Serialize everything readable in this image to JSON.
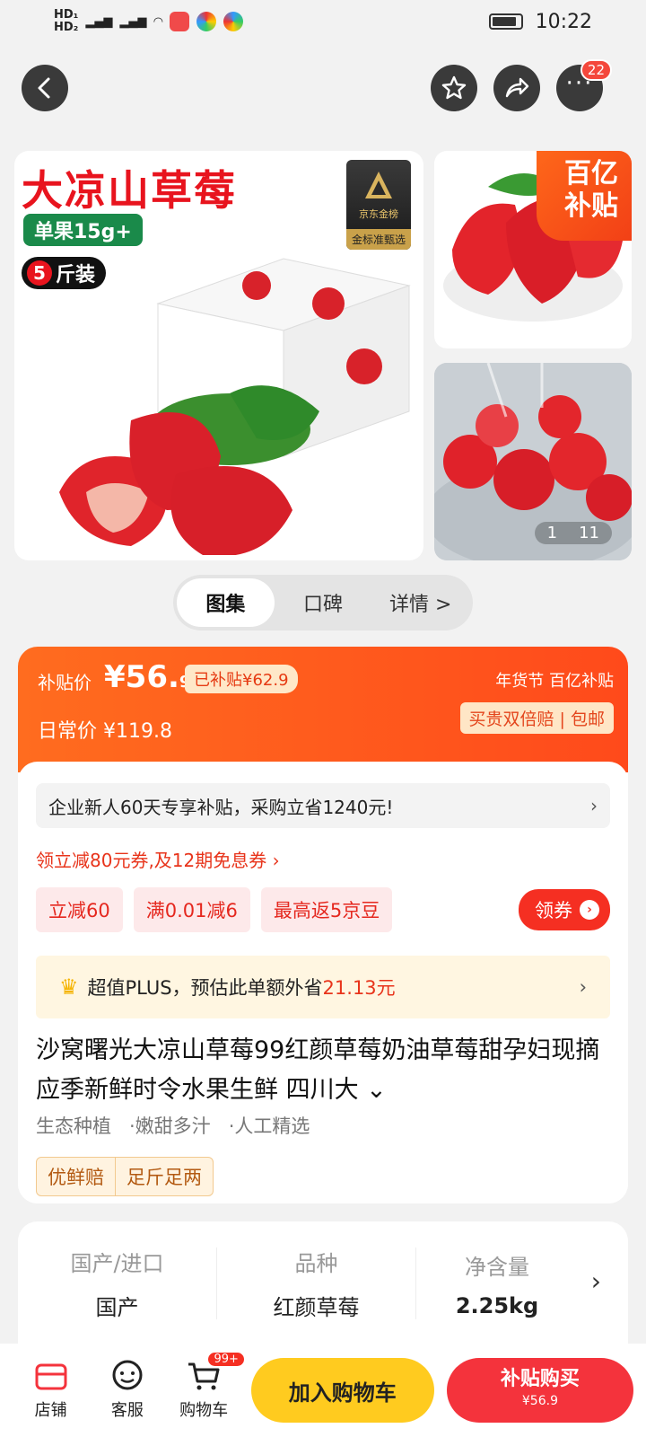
{
  "status_bar": {
    "left": "HD 4G 4G",
    "time": "10:22"
  },
  "top_nav": {
    "notification_count": "22"
  },
  "gallery": {
    "headline": "大凉山草莓",
    "weight_tag": "单果15g+",
    "pack_number": "5",
    "pack_suffix": "斤装",
    "gold_badge_top": "京东金榜",
    "gold_badge_bottom": "金标准甄选",
    "subsidy_badge_line1": "百亿",
    "subsidy_badge_line2": "补贴",
    "counter_current": "1",
    "counter_total": "11"
  },
  "tabs": [
    "图集",
    "口碑",
    "详情 >"
  ],
  "price": {
    "subsidy_label": "补贴价",
    "subsidy_price_main": "¥56.",
    "subsidy_price_decimal": "9",
    "already_subsidized": "已补贴¥62.9",
    "daily_label": "日常价",
    "daily_price": "¥119.8",
    "festival_text": "年货节  百亿补贴",
    "guarantee": "买贵双倍赔 | 包邮"
  },
  "offers": {
    "enterprise": "企业新人60天专享补贴，采购立省1240元!",
    "coupon_line": "领立减80元券,及12期免息券 ›",
    "promos": [
      "立减60",
      "满0.01减6",
      "最高返5京豆"
    ],
    "get_coupon": "领券",
    "plus_prefix": "超值PLUS，预估此单额外省",
    "plus_amount": "21.13元"
  },
  "product": {
    "title": "沙窝曙光大凉山草莓99红颜草莓奶油草莓甜孕妇现摘应季新鲜时令水果生鲜 四川大 ⌄",
    "features": [
      "生态种植",
      "·嫩甜多汁",
      "·人工精选"
    ],
    "tags": [
      "优鲜赔",
      "足斤足两"
    ]
  },
  "specs": [
    {
      "key": "国产/进口",
      "value": "国产"
    },
    {
      "key": "品种",
      "value": "红颜草莓"
    },
    {
      "key": "净含量",
      "value": "2.25kg"
    }
  ],
  "bottom_bar": {
    "shop": "店铺",
    "service": "客服",
    "cart": "购物车",
    "cart_badge": "99+",
    "add_cart": "加入购物车",
    "buy_now": "补贴购买",
    "buy_now_price": "¥56.9"
  },
  "colors": {
    "accent_red": "#f4333c",
    "accent_orange": "#ff6c1f",
    "yellow": "#ffcb1f"
  }
}
